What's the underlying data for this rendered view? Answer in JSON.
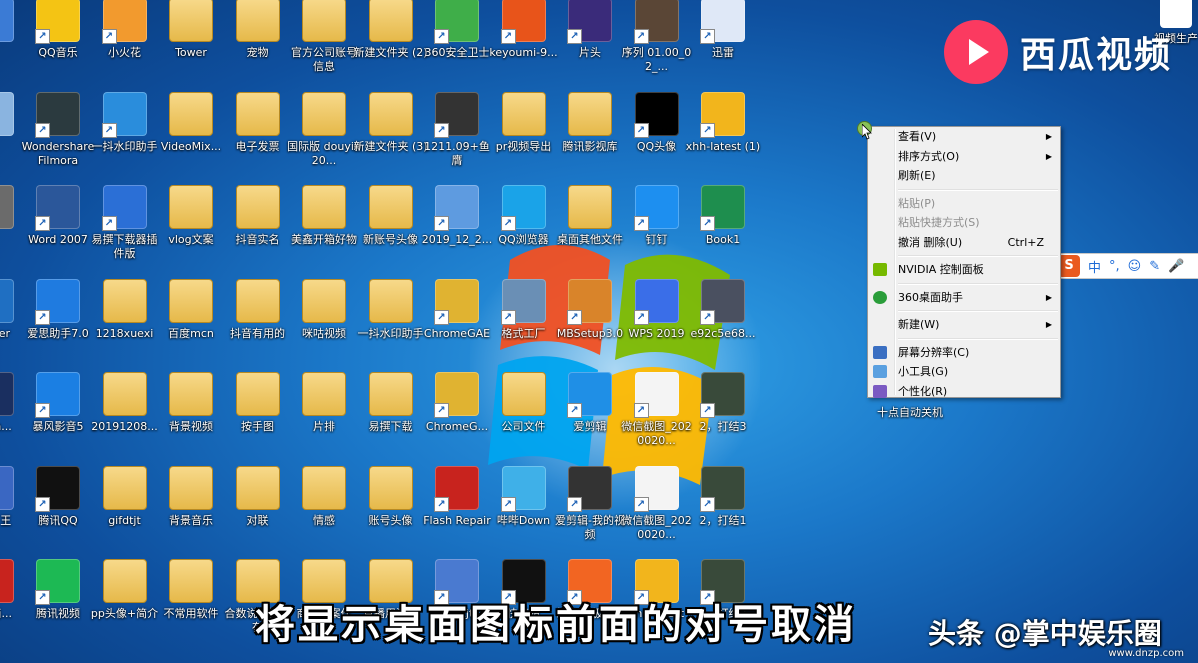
{
  "desktop_icons": [
    {
      "label": "机",
      "col": -1,
      "row": 0,
      "kind": "app",
      "color": "#3b7bd5"
    },
    {
      "label": "QQ音乐",
      "col": 0,
      "row": 0,
      "kind": "app",
      "color": "#f4c414"
    },
    {
      "label": "小火花",
      "col": 1,
      "row": 0,
      "kind": "app",
      "color": "#f29a2e"
    },
    {
      "label": "Tower",
      "col": 2,
      "row": 0,
      "kind": "folder"
    },
    {
      "label": "宠物",
      "col": 3,
      "row": 0,
      "kind": "folder"
    },
    {
      "label": "官方公司账号信息",
      "col": 4,
      "row": 0,
      "kind": "folder"
    },
    {
      "label": "新建文件夹 (2)",
      "col": 5,
      "row": 0,
      "kind": "folder"
    },
    {
      "label": "360安全卫士",
      "col": 6,
      "row": 0,
      "kind": "app",
      "color": "#3fae49"
    },
    {
      "label": "keyoumi-9...",
      "col": 7,
      "row": 0,
      "kind": "app",
      "color": "#e8541a"
    },
    {
      "label": "片头",
      "col": 8,
      "row": 0,
      "kind": "app",
      "color": "#3a2b7a"
    },
    {
      "label": "序列 01.00_02_...",
      "col": 9,
      "row": 0,
      "kind": "app",
      "color": "#5a4636"
    },
    {
      "label": "迅雷",
      "col": 10,
      "row": 0,
      "kind": "app",
      "color": "#dfe8f7"
    },
    {
      "label": "器",
      "col": -1,
      "row": 1,
      "kind": "app",
      "color": "#8ab4e0"
    },
    {
      "label": "Wondershare Filmora",
      "col": 0,
      "row": 1,
      "kind": "app",
      "color": "#2b3a3f"
    },
    {
      "label": "一抖水印助手",
      "col": 1,
      "row": 1,
      "kind": "app",
      "color": "#2a8ddc"
    },
    {
      "label": "VideoMix...",
      "col": 2,
      "row": 1,
      "kind": "folder"
    },
    {
      "label": "电子发票",
      "col": 3,
      "row": 1,
      "kind": "folder"
    },
    {
      "label": "国际版 douyin20...",
      "col": 4,
      "row": 1,
      "kind": "folder"
    },
    {
      "label": "新建文件夹 (3)",
      "col": 5,
      "row": 1,
      "kind": "folder"
    },
    {
      "label": "1211.09+鱼膺",
      "col": 6,
      "row": 1,
      "kind": "app",
      "color": "#333333"
    },
    {
      "label": "pr视频导出",
      "col": 7,
      "row": 1,
      "kind": "folder"
    },
    {
      "label": "腾讯影视库",
      "col": 8,
      "row": 1,
      "kind": "folder"
    },
    {
      "label": "QQ头像",
      "col": 9,
      "row": 1,
      "kind": "app",
      "color": "#000000"
    },
    {
      "label": "xhh-latest (1)",
      "col": 10,
      "row": 1,
      "kind": "app",
      "color": "#f2b51c"
    },
    {
      "label": "站",
      "col": -1,
      "row": 2,
      "kind": "app",
      "color": "#6b6b6b"
    },
    {
      "label": "Word 2007",
      "col": 0,
      "row": 2,
      "kind": "app",
      "color": "#2b579a"
    },
    {
      "label": "易撰下载器插件版",
      "col": 1,
      "row": 2,
      "kind": "app",
      "color": "#2b6fd6"
    },
    {
      "label": "vlog文案",
      "col": 2,
      "row": 2,
      "kind": "folder"
    },
    {
      "label": "抖音实名",
      "col": 3,
      "row": 2,
      "kind": "folder"
    },
    {
      "label": "美鑫开箱好物",
      "col": 4,
      "row": 2,
      "kind": "folder"
    },
    {
      "label": "新账号头像",
      "col": 5,
      "row": 2,
      "kind": "folder"
    },
    {
      "label": "2019_12_2...",
      "col": 6,
      "row": 2,
      "kind": "app",
      "color": "#5e9be0"
    },
    {
      "label": "QQ浏览器",
      "col": 7,
      "row": 2,
      "kind": "app",
      "color": "#1aa3e8"
    },
    {
      "label": "桌面其他文件",
      "col": 8,
      "row": 2,
      "kind": "folder"
    },
    {
      "label": "钉钉",
      "col": 9,
      "row": 2,
      "kind": "app",
      "color": "#1d8ff0"
    },
    {
      "label": "Book1",
      "col": 10,
      "row": 2,
      "kind": "app",
      "color": "#1e8e4e"
    },
    {
      "label": "net rer",
      "col": -1,
      "row": 3,
      "kind": "app",
      "color": "#1f6fc2"
    },
    {
      "label": "爱思助手7.0",
      "col": 0,
      "row": 3,
      "kind": "app",
      "color": "#1f7be0"
    },
    {
      "label": "1218xuexi",
      "col": 1,
      "row": 3,
      "kind": "folder"
    },
    {
      "label": "百度mcn",
      "col": 2,
      "row": 3,
      "kind": "folder"
    },
    {
      "label": "抖音有用的",
      "col": 3,
      "row": 3,
      "kind": "folder"
    },
    {
      "label": "咪咕视频",
      "col": 4,
      "row": 3,
      "kind": "folder"
    },
    {
      "label": "一抖水印助手",
      "col": 5,
      "row": 3,
      "kind": "folder"
    },
    {
      "label": "ChromeGAE",
      "col": 6,
      "row": 3,
      "kind": "app",
      "color": "#e0b331"
    },
    {
      "label": "格式工厂",
      "col": 7,
      "row": 3,
      "kind": "app",
      "color": "#6a8fb5"
    },
    {
      "label": "MBSetup3.0",
      "col": 8,
      "row": 3,
      "kind": "app",
      "color": "#d9842a"
    },
    {
      "label": "WPS 2019",
      "col": 9,
      "row": 3,
      "kind": "app",
      "color": "#3a6ee8"
    },
    {
      "label": "e92c5e68...",
      "col": 10,
      "row": 3,
      "kind": "app",
      "color": "#4a5060"
    },
    {
      "label": "be sh...",
      "col": -1,
      "row": 4,
      "kind": "app",
      "color": "#1a2f60"
    },
    {
      "label": "暴风影音5",
      "col": 0,
      "row": 4,
      "kind": "app",
      "color": "#1b7fe3"
    },
    {
      "label": "20191208...",
      "col": 1,
      "row": 4,
      "kind": "folder"
    },
    {
      "label": "背景视频",
      "col": 2,
      "row": 4,
      "kind": "folder"
    },
    {
      "label": "按手图",
      "col": 3,
      "row": 4,
      "kind": "folder"
    },
    {
      "label": "片排",
      "col": 4,
      "row": 4,
      "kind": "folder"
    },
    {
      "label": "易撰下载",
      "col": 5,
      "row": 4,
      "kind": "folder"
    },
    {
      "label": "ChromeG...",
      "col": 6,
      "row": 4,
      "kind": "app",
      "color": "#e0b331"
    },
    {
      "label": "公司文件",
      "col": 7,
      "row": 4,
      "kind": "folder"
    },
    {
      "label": "爱剪辑",
      "col": 8,
      "row": 4,
      "kind": "app",
      "color": "#1f8fe6"
    },
    {
      "label": "微信截图_2020020...",
      "col": 9,
      "row": 4,
      "kind": "app",
      "color": "#f4f4f4"
    },
    {
      "label": "2，打结3",
      "col": 10,
      "row": 4,
      "kind": "app",
      "color": "#394a3a"
    },
    {
      "label": "rsoft 王",
      "col": -1,
      "row": 5,
      "kind": "app",
      "color": "#3a67c2"
    },
    {
      "label": "腾讯QQ",
      "col": 0,
      "row": 5,
      "kind": "app",
      "color": "#111111"
    },
    {
      "label": "gifdtjt",
      "col": 1,
      "row": 5,
      "kind": "folder"
    },
    {
      "label": "背景音乐",
      "col": 2,
      "row": 5,
      "kind": "folder"
    },
    {
      "label": "对联",
      "col": 3,
      "row": 5,
      "kind": "folder"
    },
    {
      "label": "情感",
      "col": 4,
      "row": 5,
      "kind": "folder"
    },
    {
      "label": "账号头像",
      "col": 5,
      "row": 5,
      "kind": "folder"
    },
    {
      "label": "Flash Repair",
      "col": 6,
      "row": 5,
      "kind": "app",
      "color": "#c8231e"
    },
    {
      "label": "哔哔Down",
      "col": 7,
      "row": 5,
      "kind": "app",
      "color": "#3fb0e8"
    },
    {
      "label": "爱剪辑-我的视频",
      "col": 8,
      "row": 5,
      "kind": "app",
      "color": "#333333"
    },
    {
      "label": "微信截图_2020020...",
      "col": 9,
      "row": 5,
      "kind": "app",
      "color": "#f4f4f4"
    },
    {
      "label": "2，打结1",
      "col": 10,
      "row": 5,
      "kind": "app",
      "color": "#394a3a"
    },
    {
      "label": "AD 简...",
      "col": -1,
      "row": 6,
      "kind": "app",
      "color": "#c8231e"
    },
    {
      "label": "腾讯视频",
      "col": 0,
      "row": 6,
      "kind": "app",
      "color": "#1db954"
    },
    {
      "label": "pp头像+简介",
      "col": 1,
      "row": 6,
      "kind": "folder"
    },
    {
      "label": "不常用软件",
      "col": 2,
      "row": 6,
      "kind": "folder"
    },
    {
      "label": "合数说滤镜保存",
      "col": 3,
      "row": 6,
      "kind": "folder"
    },
    {
      "label": "商品文案作",
      "col": 4,
      "row": 6,
      "kind": "folder"
    },
    {
      "label": "直播用资料",
      "col": 5,
      "row": 6,
      "kind": "folder"
    },
    {
      "label": "gifdtjt",
      "col": 6,
      "row": 6,
      "kind": "app",
      "color": "#4a7ad0"
    },
    {
      "label": "快剪辑",
      "col": 7,
      "row": 6,
      "kind": "app",
      "color": "#111111"
    },
    {
      "label": "芒果TV极速版",
      "col": 8,
      "row": 6,
      "kind": "app",
      "color": "#f26522"
    },
    {
      "label": "xhh-latest",
      "col": 9,
      "row": 6,
      "kind": "app",
      "color": "#f2b51c"
    },
    {
      "label": "2，打结2",
      "col": 10,
      "row": 6,
      "kind": "app",
      "color": "#394a3a"
    }
  ],
  "extra_icons": {
    "top_right_label": "视频生产",
    "shutdown_label": "十点自动关机"
  },
  "context_menu": {
    "items": [
      {
        "label": "查看(V)",
        "type": "submenu",
        "enabled": true
      },
      {
        "label": "排序方式(O)",
        "type": "submenu",
        "enabled": true
      },
      {
        "label": "刷新(E)",
        "type": "item",
        "enabled": true
      },
      {
        "type": "separator"
      },
      {
        "label": "粘贴(P)",
        "type": "item",
        "enabled": false
      },
      {
        "label": "粘贴快捷方式(S)",
        "type": "item",
        "enabled": false
      },
      {
        "label": "撤消 删除(U)",
        "type": "item",
        "enabled": true,
        "shortcut": "Ctrl+Z"
      },
      {
        "type": "separator"
      },
      {
        "label": "NVIDIA 控制面板",
        "type": "item",
        "enabled": true,
        "icon": "nvidia-icon"
      },
      {
        "type": "separator"
      },
      {
        "label": "360桌面助手",
        "type": "submenu",
        "enabled": true,
        "icon": "360-icon"
      },
      {
        "type": "separator"
      },
      {
        "label": "新建(W)",
        "type": "submenu",
        "enabled": true
      },
      {
        "type": "separator"
      },
      {
        "label": "屏幕分辨率(C)",
        "type": "item",
        "enabled": true,
        "icon": "monitor-icon"
      },
      {
        "label": "小工具(G)",
        "type": "item",
        "enabled": true,
        "icon": "gadgets-icon"
      },
      {
        "label": "个性化(R)",
        "type": "item",
        "enabled": true,
        "icon": "personalize-icon"
      }
    ]
  },
  "ime_toolbar": {
    "logo": "S",
    "items": [
      "中",
      "°,",
      "☺",
      "✎",
      "🎤"
    ]
  },
  "watermark": {
    "text": "西瓜视频"
  },
  "subtitle": "将显示桌面图标前面的对号取消",
  "credit": "头条 @掌中娱乐圈",
  "corner_watermark": "www.dnzp.com",
  "colors": {
    "menu_bg": "#f0f0f0",
    "accent": "#fb3a60"
  }
}
